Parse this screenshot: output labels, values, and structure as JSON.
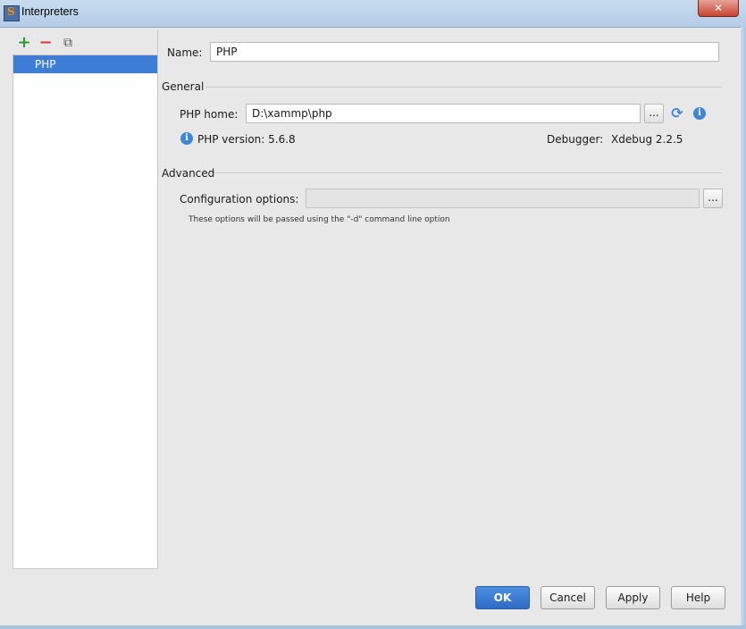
{
  "window": {
    "title": "Interpreters",
    "close_label": "✕"
  },
  "toolbar": {
    "add": "+",
    "remove": "−",
    "copy": "⧉"
  },
  "interpreters": [
    "PHP"
  ],
  "form": {
    "name_label": "Name:",
    "name_value": "PHP",
    "general_title": "General",
    "php_home_label": "PHP home:",
    "php_home_value": "D:\\xammp\\php",
    "browse_label": "...",
    "php_version_text": "PHP version: 5.6.8",
    "debugger_label": "Debugger:",
    "debugger_value": "Xdebug 2.2.5",
    "advanced_title": "Advanced",
    "config_label": "Configuration options:",
    "config_value": "",
    "config_hint": "These options will be passed using the \"-d\" command line option"
  },
  "buttons": {
    "ok": "OK",
    "cancel": "Cancel",
    "apply": "Apply",
    "help": "Help"
  },
  "colors": {
    "selection": "#3d7dd6",
    "add": "#2e9a2e",
    "remove": "#d23b3b",
    "info": "#3f86d2"
  }
}
